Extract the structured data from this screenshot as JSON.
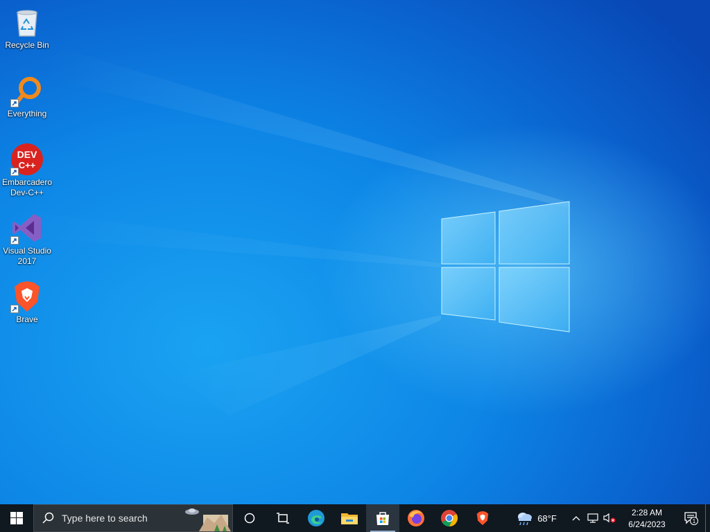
{
  "desktop": {
    "icons": [
      {
        "label": "Recycle Bin",
        "icon": "recycle-bin-icon",
        "shortcut": false
      },
      {
        "label": "Everything",
        "icon": "everything-search-icon",
        "shortcut": true
      },
      {
        "label": "Embarcadero Dev-C++",
        "icon": "devcpp-icon",
        "shortcut": true,
        "badge": "DEV C++"
      },
      {
        "label": "Visual Studio 2017",
        "icon": "visual-studio-icon",
        "shortcut": true
      },
      {
        "label": "Brave",
        "icon": "brave-icon",
        "shortcut": true
      }
    ]
  },
  "taskbar": {
    "search_placeholder": "Type here to search",
    "pinned": [
      "edge-icon",
      "file-explorer-icon",
      "microsoft-store-icon",
      "firefox-icon",
      "chrome-icon",
      "brave-icon"
    ],
    "active_app": "microsoft-store-icon",
    "weather": {
      "temp": "68°F",
      "icon": "cloudy-rain-icon"
    },
    "clock": {
      "time": "2:28 AM",
      "date": "6/24/2023"
    },
    "notifications": {
      "count": "1"
    }
  },
  "colors": {
    "taskbar_bg": "#101820",
    "wallpaper_main": "#0d86e6",
    "accent": "#0078d7"
  }
}
